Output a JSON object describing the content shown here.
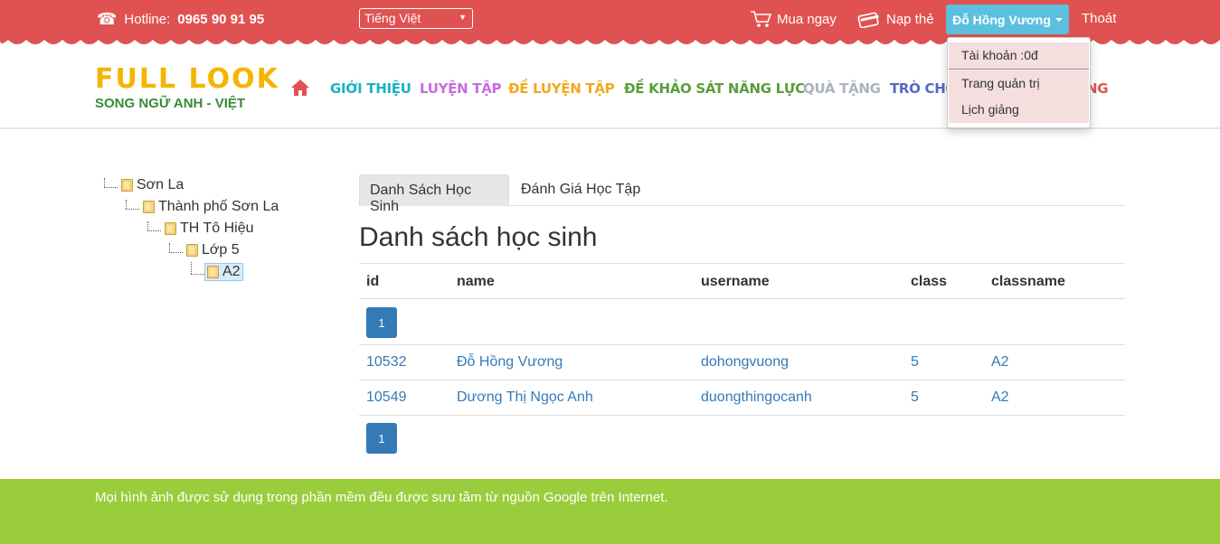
{
  "topbar": {
    "hotline_label": "Hotline:",
    "hotline_number": "0965 90 91 95",
    "language": "Tiếng Việt",
    "buy_now": "Mua ngay",
    "top_up": "Nạp thẻ",
    "user_name": "Đỗ Hồng Vương",
    "logout": "Thoát",
    "color": "#e05252"
  },
  "logo": {
    "title": "FULL LOOK",
    "subtitle": "SONG NGỮ ANH - VIỆT"
  },
  "nav": [
    {
      "label": "GIỚI THIỆU",
      "color": "#1ab3c2"
    },
    {
      "label": "LUYỆN TẬP",
      "color": "#c86be0"
    },
    {
      "label": "ĐỀ LUYỆN TẬP",
      "color": "#f2a81d"
    },
    {
      "label": "ĐỀ KHẢO SÁT NĂNG LỰC",
      "color": "#5a9e3a"
    },
    {
      "label": "QUÀ TẶNG",
      "color": "#a9b4be"
    },
    {
      "label": "TRÒ CHƠI",
      "color": "#5567c9"
    },
    {
      "label": "NG",
      "color": "#e05252"
    }
  ],
  "dropdown": {
    "items": [
      "Tài khoản :0đ",
      "Trang quản trị",
      "Lịch giảng"
    ]
  },
  "tree": {
    "nodes": [
      "Sơn La",
      "Thành phố Sơn La",
      "TH Tô Hiệu",
      "Lớp 5",
      "A2"
    ]
  },
  "tabs": [
    "Danh Sách Học Sinh",
    "Đánh Giá Học Tập"
  ],
  "main": {
    "title": "Danh sách học sinh",
    "columns": [
      "id",
      "name",
      "username",
      "class",
      "classname"
    ],
    "page": "1",
    "rows": [
      {
        "id": "10532",
        "name": "Đỗ Hồng Vương",
        "username": "dohongvuong",
        "class": "5",
        "classname": "A2"
      },
      {
        "id": "10549",
        "name": "Dương Thị Ngọc Anh",
        "username": "duongthingocanh",
        "class": "5",
        "classname": "A2"
      }
    ]
  },
  "footer": {
    "text": "Mọi hình ảnh được sử dụng trong phần mềm đều được sưu tầm từ nguồn Google trên Internet.",
    "color": "#9acd3c"
  }
}
